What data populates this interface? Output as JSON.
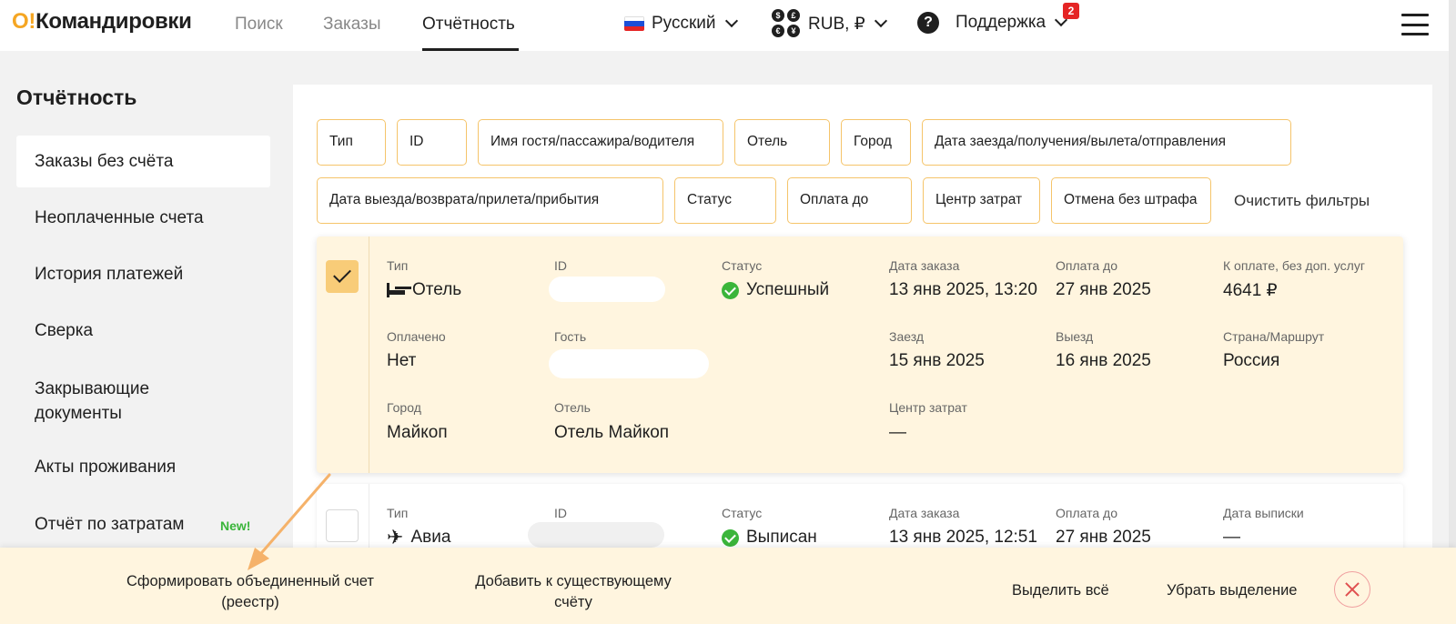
{
  "header": {
    "logo_prefix": "O!",
    "logo_text": "Командировки",
    "nav": [
      "Поиск",
      "Заказы",
      "Отчётность"
    ],
    "language": "Русский",
    "currency": "RUB, ₽",
    "support": "Поддержка",
    "support_badge": "2",
    "help_icon": "?"
  },
  "sidebar": {
    "title": "Отчётность",
    "items": [
      "Заказы без счёта",
      "Неоплаченные счета",
      "История платежей",
      "Сверка",
      "Закрывающие документы",
      "Акты проживания",
      "Отчёт по затратам"
    ],
    "new_badge": "New!"
  },
  "filters": {
    "row1": [
      "Тип",
      "ID",
      "Имя гостя/пассажира/водителя",
      "Отель",
      "Город",
      "Дата заезда/получения/вылета/отправления"
    ],
    "row2": [
      "Дата выезда/возврата/прилета/прибытия",
      "Статус",
      "Оплата до",
      "Центр затрат",
      "Отмена без штрафа"
    ],
    "clear": "Очистить фильтры"
  },
  "orders": [
    {
      "type_label": "Тип",
      "type": "Отель",
      "id_label": "ID",
      "status_label": "Статус",
      "status": "Успешный",
      "date_label": "Дата заказа",
      "date": "13 янв 2025, 13:20",
      "pay_label": "Оплата до",
      "pay": "27 янв 2025",
      "amount_label": "К оплате, без доп. услуг",
      "amount": "4641 ₽",
      "paid_label": "Оплачено",
      "paid": "Нет",
      "guest_label": "Гость",
      "checkin_label": "Заезд",
      "checkin": "15 янв 2025",
      "checkout_label": "Выезд",
      "checkout": "16 янв 2025",
      "country_label": "Страна/Маршрут",
      "country": "Россия",
      "city_label": "Город",
      "city": "Майкоп",
      "hotel_label": "Отель",
      "hotel": "Отель Майкоп",
      "cost_label": "Центр затрат",
      "cost": "—",
      "selected": true
    },
    {
      "type_label": "Тип",
      "type": "Авиа",
      "id_label": "ID",
      "status_label": "Статус",
      "status": "Выписан",
      "date_label": "Дата заказа",
      "date": "13 янв 2025, 12:51",
      "pay_label": "Оплата до",
      "pay": "27 янв 2025",
      "issue_label": "Дата выписки",
      "issue": "—",
      "selected": false
    }
  ],
  "bottom_bar": {
    "create_line1": "Сформировать объединенный счет",
    "create_line2": "(реестр)",
    "add_line1": "Добавить к существующему",
    "add_line2": "счёту",
    "select_all": "Выделить всё",
    "deselect": "Убрать выделение"
  },
  "colors": {
    "accent": "#f5a623",
    "selected_bg": "#fff5df",
    "success": "#3ab53a",
    "badge": "#e52525"
  }
}
